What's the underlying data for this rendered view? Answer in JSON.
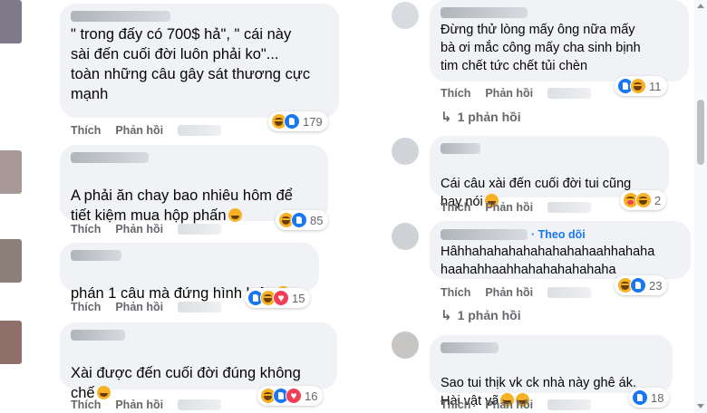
{
  "actions": {
    "like": "Thích",
    "reply": "Phản hồi"
  },
  "left_comments": [
    {
      "text": "\" trong đấy có 700$ hả\", \" cái này\nsài đến cuối đời luôn phải ko\"...\ntoàn những câu gây sát thương cực\nmạnh",
      "reactions": [
        "haha",
        "like"
      ],
      "count": "179"
    },
    {
      "text": "A phải ăn chay bao nhiêu hôm để\ntiết kiệm mua hộp phấn",
      "reactions": [
        "haha",
        "like"
      ],
      "count": "85"
    },
    {
      "text": "phán 1 câu mà đứng hình luôn",
      "reactions": [
        "like",
        "haha",
        "love"
      ],
      "count": "15"
    },
    {
      "text": "Xài được đến cuối đời đúng không\nchế",
      "reactions": [
        "haha",
        "like",
        "love"
      ],
      "count": "16"
    }
  ],
  "right_comments": [
    {
      "text": "Đừng thử lòng mấy ông nữa mấy\nbà ơi mắc công mấy cha sinh bịnh\ntim chết tức chết tủi chèn",
      "reactions": [
        "like",
        "haha"
      ],
      "count": "11",
      "replies": "1 phản hồi"
    },
    {
      "text": "Cái câu xài đến cuối đời tui cũng\nhay nói",
      "reactions": [
        "care",
        "haha"
      ],
      "count": "2"
    },
    {
      "follow": "· Theo dõi",
      "text": "Hâhhahahahahahahahahaahhahaha\nhaahahhaahhahahahahahaha",
      "reactions": [
        "haha",
        "like"
      ],
      "count": "23",
      "replies": "1 phản hồi"
    },
    {
      "text": "Sao tui thịk vk ck nhà này ghê ák.\nHài vật vã",
      "reactions": [
        "like"
      ],
      "count": "18"
    }
  ],
  "colors": {
    "text": "#050505",
    "secondary": "#65676b",
    "bubble": "#f0f2f5",
    "link": "#1877f2"
  }
}
